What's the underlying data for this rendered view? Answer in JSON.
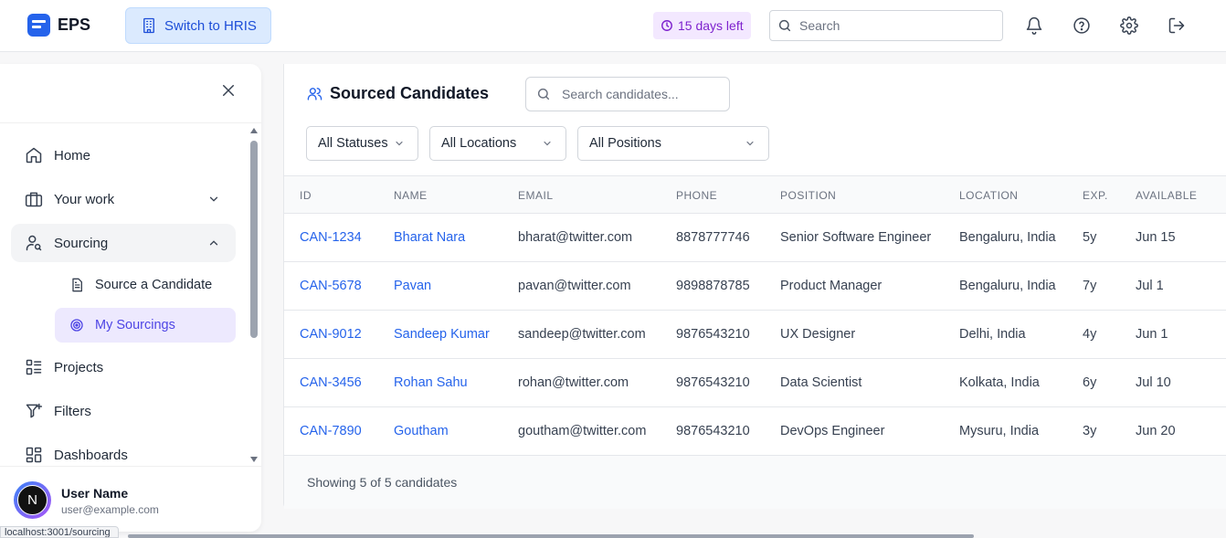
{
  "app": {
    "logo_text": "EPS",
    "switch_label": "Switch to HRIS",
    "trial_text": "15 days left",
    "search_placeholder": "Search"
  },
  "colors": {
    "accent": "#2563eb",
    "trial": "#7e22ce",
    "active_nav": "#4f46e5"
  },
  "topbar_icons": [
    "bell-icon",
    "help-icon",
    "settings-icon",
    "logout-icon"
  ],
  "sidebar": {
    "items": [
      {
        "label": "Home",
        "icon": "home-icon"
      },
      {
        "label": "Your work",
        "icon": "briefcase-icon"
      },
      {
        "label": "Sourcing",
        "icon": "user-search-icon"
      },
      {
        "label": "Projects",
        "icon": "list-icon"
      },
      {
        "label": "Filters",
        "icon": "filter-icon"
      },
      {
        "label": "Dashboards",
        "icon": "grid-icon"
      }
    ],
    "sub_items": [
      {
        "label": "Source a Candidate",
        "icon": "document-icon"
      },
      {
        "label": "My Sourcings",
        "icon": "target-icon"
      }
    ]
  },
  "user": {
    "initial": "N",
    "name": "User Name",
    "email": "user@example.com"
  },
  "status_link": "localhost:3001/sourcing",
  "main": {
    "title": "Sourced Candidates",
    "search_placeholder": "Search candidates...",
    "filters": [
      "All Statuses",
      "All Locations",
      "All Positions"
    ],
    "columns": [
      "ID",
      "NAME",
      "EMAIL",
      "PHONE",
      "POSITION",
      "LOCATION",
      "EXP.",
      "AVAILABLE"
    ],
    "rows": [
      {
        "id": "CAN-1234",
        "name": "Bharat Nara",
        "email": "bharat@twitter.com",
        "phone": "8878777746",
        "position": "Senior Software Engineer",
        "location": "Bengaluru, India",
        "exp": "5y",
        "available": "Jun 15"
      },
      {
        "id": "CAN-5678",
        "name": "Pavan",
        "email": "pavan@twitter.com",
        "phone": "9898878785",
        "position": "Product Manager",
        "location": "Bengaluru, India",
        "exp": "7y",
        "available": "Jul 1"
      },
      {
        "id": "CAN-9012",
        "name": "Sandeep Kumar",
        "email": "sandeep@twitter.com",
        "phone": "9876543210",
        "position": "UX Designer",
        "location": "Delhi, India",
        "exp": "4y",
        "available": "Jun 1"
      },
      {
        "id": "CAN-3456",
        "name": "Rohan Sahu",
        "email": "rohan@twitter.com",
        "phone": "9876543210",
        "position": "Data Scientist",
        "location": "Kolkata, India",
        "exp": "6y",
        "available": "Jul 10"
      },
      {
        "id": "CAN-7890",
        "name": "Goutham",
        "email": "goutham@twitter.com",
        "phone": "9876543210",
        "position": "DevOps Engineer",
        "location": "Mysuru, India",
        "exp": "3y",
        "available": "Jun 20"
      }
    ],
    "footer": "Showing 5 of 5 candidates"
  }
}
